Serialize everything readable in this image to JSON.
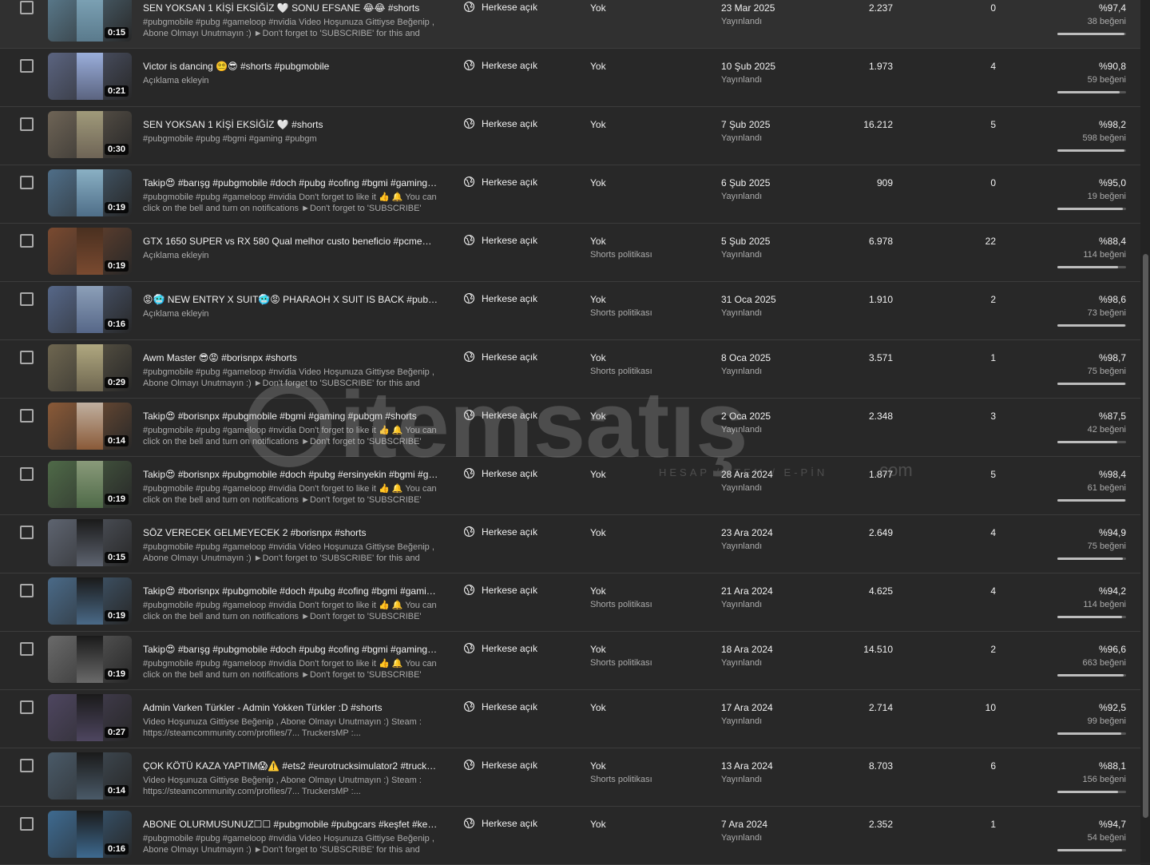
{
  "visibility_label": "Herkese açık",
  "rows": [
    {
      "duration": "0:15",
      "title": "SEN YOKSAN 1 KİŞİ EKSİĞİZ 🤍 SONU EFSANE 😂😂 #shorts",
      "desc": "#pubgmobile #pubg #gameloop #nvidia Video Hoşunuza Gittiyse Beğenip , Abone Olmayı Unutmayın :) ►Don't forget to 'SUBSCRIBE' for this and simila...",
      "restriction": "Yok",
      "restriction_sub": "",
      "date": "23 Mar 2025",
      "status": "Yayınlandı",
      "views": "2.237",
      "comments": "0",
      "likes_pct": "%97,4",
      "likes_count": "38 beğeni",
      "like_ratio": 0.974,
      "thumb_bg": "#5a7a8c",
      "thumb_clip": "#7fa5b8"
    },
    {
      "duration": "0:21",
      "title": "Victor is dancing 😵‍💫😎 #shorts #pubgmobile",
      "desc": "Açıklama ekleyin",
      "restriction": "Yok",
      "restriction_sub": "",
      "date": "10 Şub 2025",
      "status": "Yayınlandı",
      "views": "1.973",
      "comments": "4",
      "likes_pct": "%90,8",
      "likes_count": "59 beğeni",
      "like_ratio": 0.908,
      "thumb_bg": "#5b6480",
      "thumb_clip": "#9aaedb"
    },
    {
      "duration": "0:30",
      "title": "SEN YOKSAN 1 KİŞİ EKSİĞİZ 🤍 #shorts",
      "desc": "#pubgmobile #pubg #bgmi #gaming #pubgm",
      "restriction": "Yok",
      "restriction_sub": "",
      "date": "7 Şub 2025",
      "status": "Yayınlandı",
      "views": "16.212",
      "comments": "5",
      "likes_pct": "%98,2",
      "likes_count": "598 beğeni",
      "like_ratio": 0.982,
      "thumb_bg": "#6e6456",
      "thumb_clip": "#a09a7a"
    },
    {
      "duration": "0:19",
      "title": "Takip😍 #barışg #pubgmobile #doch #pubg #cofing #bgmi #gaming #...",
      "desc": "#pubgmobile #pubg #gameloop #nvidia Don't forget to like it 👍 🔔 You can click on the bell and turn on notifications ►Don't forget to 'SUBSCRIBE' for...",
      "restriction": "Yok",
      "restriction_sub": "",
      "date": "6 Şub 2025",
      "status": "Yayınlandı",
      "views": "909",
      "comments": "0",
      "likes_pct": "%95,0",
      "likes_count": "19 beğeni",
      "like_ratio": 0.95,
      "thumb_bg": "#4f6e88",
      "thumb_clip": "#8ab0c4"
    },
    {
      "duration": "0:19",
      "title": "GTX 1650 SUPER vs RX 580 Qual melhor custo beneficio #pcmemes #r...",
      "desc": "Açıklama ekleyin",
      "restriction": "Yok",
      "restriction_sub": "Shorts politikası",
      "date": "5 Şub 2025",
      "status": "Yayınlandı",
      "views": "6.978",
      "comments": "22",
      "likes_pct": "%88,4",
      "likes_count": "114 beğeni",
      "like_ratio": 0.884,
      "thumb_bg": "#7a4a30",
      "thumb_clip": "#4a3020"
    },
    {
      "duration": "0:16",
      "title": "😡🥶 NEW ENTRY X SUIT🥶😡 PHARAOH X SUIT IS BACK #pubgmobi...",
      "desc": "Açıklama ekleyin",
      "restriction": "Yok",
      "restriction_sub": "Shorts politikası",
      "date": "31 Oca 2025",
      "status": "Yayınlandı",
      "views": "1.910",
      "comments": "2",
      "likes_pct": "%98,6",
      "likes_count": "73 beğeni",
      "like_ratio": 0.986,
      "thumb_bg": "#566788",
      "thumb_clip": "#8c9fb8"
    },
    {
      "duration": "0:29",
      "title": "Awm Master 😎😡 #borisnpx #shorts",
      "desc": "#pubgmobile #pubg #gameloop #nvidia Video Hoşunuza Gittiyse Beğenip , Abone Olmayı Unutmayın :) ►Don't forget to 'SUBSCRIBE' for this and simila...",
      "restriction": "Yok",
      "restriction_sub": "Shorts politikası",
      "date": "8 Oca 2025",
      "status": "Yayınlandı",
      "views": "3.571",
      "comments": "1",
      "likes_pct": "%98,7",
      "likes_count": "75 beğeni",
      "like_ratio": 0.987,
      "thumb_bg": "#6e6650",
      "thumb_clip": "#b0a880"
    },
    {
      "duration": "0:14",
      "title": "Takip😍 #borisnpx #pubgmobile #bgmi #gaming #pubgm #shorts",
      "desc": "#pubgmobile #pubg #gameloop #nvidia Don't forget to like it 👍 🔔 You can click on the bell and turn on notifications ►Don't forget to 'SUBSCRIBE' for...",
      "restriction": "Yok",
      "restriction_sub": "",
      "date": "2 Oca 2025",
      "status": "Yayınlandı",
      "views": "2.348",
      "comments": "3",
      "likes_pct": "%87,5",
      "likes_count": "42 beğeni",
      "like_ratio": 0.875,
      "thumb_bg": "#8a5a38",
      "thumb_clip": "#c0b0a0"
    },
    {
      "duration": "0:19",
      "title": "Takip😍 #borisnpx #pubgmobile #doch #pubg #ersinyekin #bgmi #ga...",
      "desc": "#pubgmobile #pubg #gameloop #nvidia Don't forget to like it 👍 🔔 You can click on the bell and turn on notifications ►Don't forget to 'SUBSCRIBE' for...",
      "restriction": "Yok",
      "restriction_sub": "",
      "date": "28 Ara 2024",
      "status": "Yayınlandı",
      "views": "1.877",
      "comments": "5",
      "likes_pct": "%98,4",
      "likes_count": "61 beğeni",
      "like_ratio": 0.984,
      "thumb_bg": "#4f6a48",
      "thumb_clip": "#8a9a7a"
    },
    {
      "duration": "0:15",
      "title": "SÖZ VERECEK GELMEYECEK 2 #borisnpx #shorts",
      "desc": "#pubgmobile #pubg #gameloop #nvidia Video Hoşunuza Gittiyse Beğenip , Abone Olmayı Unutmayın :) ►Don't forget to 'SUBSCRIBE' for this and simila...",
      "restriction": "Yok",
      "restriction_sub": "",
      "date": "23 Ara 2024",
      "status": "Yayınlandı",
      "views": "2.649",
      "comments": "4",
      "likes_pct": "%94,9",
      "likes_count": "75 beğeni",
      "like_ratio": 0.949,
      "thumb_bg": "#5e6470",
      "thumb_clip": "#1a1a1a"
    },
    {
      "duration": "0:19",
      "title": "Takip😍 #borisnpx #pubgmobile #doch #pubg #cofing #bgmi #gaming...",
      "desc": "#pubgmobile #pubg #gameloop #nvidia Don't forget to like it 👍 🔔 You can click on the bell and turn on notifications ►Don't forget to 'SUBSCRIBE' for...",
      "restriction": "Yok",
      "restriction_sub": "Shorts politikası",
      "date": "21 Ara 2024",
      "status": "Yayınlandı",
      "views": "4.625",
      "comments": "4",
      "likes_pct": "%94,2",
      "likes_count": "114 beğeni",
      "like_ratio": 0.942,
      "thumb_bg": "#4a6a88",
      "thumb_clip": "#1a1a1a"
    },
    {
      "duration": "0:19",
      "title": "Takip😍 #barışg #pubgmobile #doch #pubg #cofing #bgmi #gaming #...",
      "desc": "#pubgmobile #pubg #gameloop #nvidia Don't forget to like it 👍 🔔 You can click on the bell and turn on notifications ►Don't forget to 'SUBSCRIBE' for...",
      "restriction": "Yok",
      "restriction_sub": "Shorts politikası",
      "date": "18 Ara 2024",
      "status": "Yayınlandı",
      "views": "14.510",
      "comments": "2",
      "likes_pct": "%96,6",
      "likes_count": "663 beğeni",
      "like_ratio": 0.966,
      "thumb_bg": "#6a6a6a",
      "thumb_clip": "#1a1a1a"
    },
    {
      "duration": "0:27",
      "title": "Admin Varken Türkler - Admin Yokken Türkler :D #shorts",
      "desc": "Video Hoşunuza Gittiyse Beğenip , Abone Olmayı Unutmayın :) Steam : https://steamcommunity.com/profiles/7... TruckersMP :...",
      "restriction": "Yok",
      "restriction_sub": "",
      "date": "17 Ara 2024",
      "status": "Yayınlandı",
      "views": "2.714",
      "comments": "10",
      "likes_pct": "%92,5",
      "likes_count": "99 beğeni",
      "like_ratio": 0.925,
      "thumb_bg": "#4e4660",
      "thumb_clip": "#1a1a1a"
    },
    {
      "duration": "0:14",
      "title": "ÇOK KÖTÜ KAZA YAPTIM😱⚠️ #ets2 #eurotrucksimulator2 #truckers...",
      "desc": "Video Hoşunuza Gittiyse Beğenip , Abone Olmayı Unutmayın :) Steam : https://steamcommunity.com/profiles/7... TruckersMP :...",
      "restriction": "Yok",
      "restriction_sub": "Shorts politikası",
      "date": "13 Ara 2024",
      "status": "Yayınlandı",
      "views": "8.703",
      "comments": "6",
      "likes_pct": "%88,1",
      "likes_count": "156 beğeni",
      "like_ratio": 0.881,
      "thumb_bg": "#4a5a68",
      "thumb_clip": "#1a1a1a"
    },
    {
      "duration": "0:16",
      "title": "ABONE OLURMUSUNUZ☐☐ #pubgmobile #pubgcars #keşfet #keşfette...",
      "desc": "#pubgmobile #pubg #gameloop #nvidia Video Hoşunuza Gittiyse Beğenip , Abone Olmayı Unutmayın :) ►Don't forget to 'SUBSCRIBE' for this and simila...",
      "restriction": "Yok",
      "restriction_sub": "",
      "date": "7 Ara 2024",
      "status": "Yayınlandı",
      "views": "2.352",
      "comments": "1",
      "likes_pct": "%94,7",
      "likes_count": "54 beğeni",
      "like_ratio": 0.947,
      "thumb_bg": "#3e6a90",
      "thumb_clip": "#1a1a1a"
    }
  ],
  "watermark": {
    "brand": "itemsatış",
    "tagline": "HESAP / İTEM / E-PİN",
    "domain": ".com"
  },
  "colors": {
    "background": "#282828",
    "row_divider": "#3c3c3c",
    "primary_text": "#f1f1f1",
    "secondary_text": "#aaaaaa",
    "like_bar_track": "#555555",
    "like_bar_fill": "#bdbdbd"
  }
}
